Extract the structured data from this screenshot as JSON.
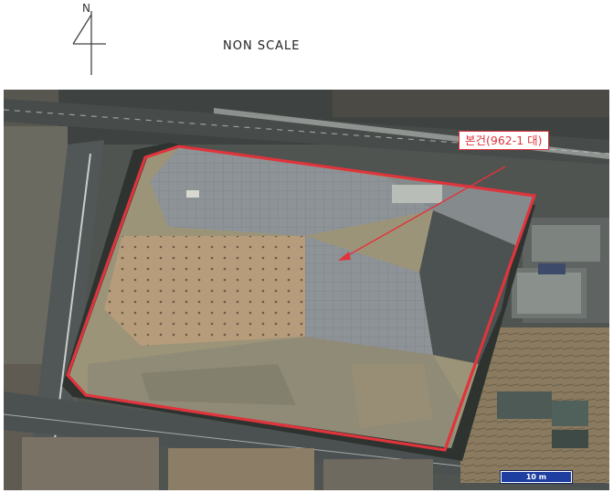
{
  "header": {
    "north_label": "N",
    "scale_note": "NON SCALE"
  },
  "map": {
    "site_label": "본건(962-1 대)",
    "scale_bar_label": "10 m",
    "boundary_color": "#e0343c"
  }
}
